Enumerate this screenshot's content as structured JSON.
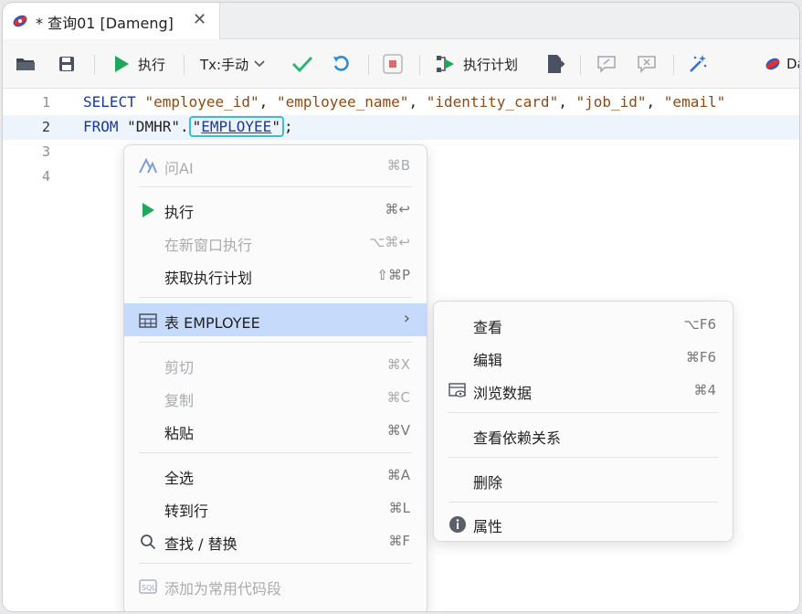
{
  "tab": {
    "title": "* 查询01 [Dameng]",
    "close": "✕"
  },
  "toolbar": {
    "run_label": "执行",
    "tx_label": "Tx:手动",
    "plan_label": "执行计划",
    "connection_label": "Da"
  },
  "editor": {
    "line_numbers": [
      "1",
      "2",
      "3",
      "4"
    ],
    "line1": {
      "kw": "SELECT ",
      "s1": "\"employee_id\"",
      "c1": ", ",
      "s2": "\"employee_name\"",
      "c2": ", ",
      "s3": "\"identity_card\"",
      "c3": ", ",
      "s4": "\"job_id\"",
      "c4": ", ",
      "s5": "\"email\""
    },
    "line2": {
      "kw": "FROM ",
      "schema": "\"DMHR\".",
      "q_open": "\"",
      "table": "EMPLOYEE",
      "q_close": "\"",
      "semi": ";"
    }
  },
  "menu": {
    "ask_ai": {
      "label": "问AI",
      "shortcut": "⌘B"
    },
    "run": {
      "label": "执行",
      "shortcut": "⌘↩"
    },
    "run_new_window": {
      "label": "在新窗口执行",
      "shortcut": "⌥⌘↩"
    },
    "get_plan": {
      "label": "获取执行计划",
      "shortcut": "⇧⌘P"
    },
    "table": {
      "label": "表 EMPLOYEE",
      "arrow": "›"
    },
    "cut": {
      "label": "剪切",
      "shortcut": "⌘X"
    },
    "copy": {
      "label": "复制",
      "shortcut": "⌘C"
    },
    "paste": {
      "label": "粘贴",
      "shortcut": "⌘V"
    },
    "select_all": {
      "label": "全选",
      "shortcut": "⌘A"
    },
    "goto_line": {
      "label": "转到行",
      "shortcut": "⌘L"
    },
    "find_replace": {
      "label": "查找 / 替换",
      "shortcut": "⌘F"
    },
    "add_snippet": {
      "label": "添加为常用代码段",
      "shortcut": ""
    }
  },
  "submenu": {
    "view": {
      "label": "查看",
      "shortcut": "⌥F6"
    },
    "edit": {
      "label": "编辑",
      "shortcut": "⌘F6"
    },
    "browse": {
      "label": "浏览数据",
      "shortcut": "⌘4"
    },
    "deps": {
      "label": "查看依赖关系",
      "shortcut": ""
    },
    "delete": {
      "label": "删除",
      "shortcut": ""
    },
    "properties": {
      "label": "属性",
      "shortcut": ""
    }
  },
  "colors": {
    "accent": "#1fa85a",
    "selection": "#c6dbfb",
    "highlight_border": "#3bc0c8"
  }
}
